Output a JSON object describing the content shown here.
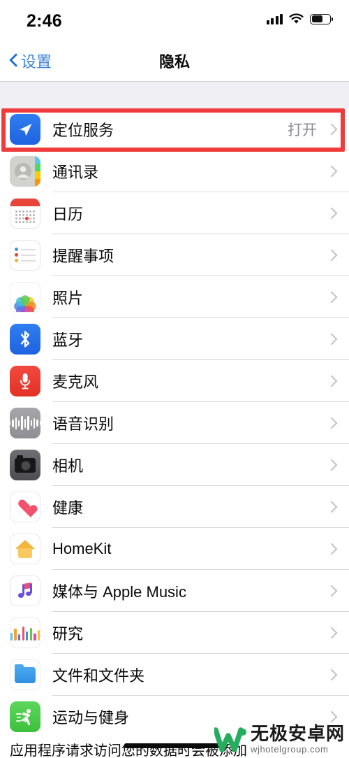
{
  "statusbar": {
    "time": "2:46",
    "signal_icon": "cellular-bars-icon",
    "wifi_icon": "wifi-icon",
    "battery_icon": "battery-icon",
    "battery_level_pct": 62
  },
  "navbar": {
    "back_label": "设置",
    "back_icon": "chevron-left-icon",
    "title": "隐私"
  },
  "highlight": {
    "color": "#ef3b3b",
    "target": "定位服务"
  },
  "list": {
    "rows": [
      {
        "label": "定位服务",
        "value": "打开",
        "icon": "location-arrow-icon",
        "chevron": "chevron-right-icon"
      },
      {
        "label": "通讯录",
        "value": "",
        "icon": "contacts-icon",
        "chevron": "chevron-right-icon"
      },
      {
        "label": "日历",
        "value": "",
        "icon": "calendar-icon",
        "chevron": "chevron-right-icon"
      },
      {
        "label": "提醒事项",
        "value": "",
        "icon": "reminders-icon",
        "chevron": "chevron-right-icon"
      },
      {
        "label": "照片",
        "value": "",
        "icon": "photos-icon",
        "chevron": "chevron-right-icon"
      },
      {
        "label": "蓝牙",
        "value": "",
        "icon": "bluetooth-icon",
        "chevron": "chevron-right-icon"
      },
      {
        "label": "麦克风",
        "value": "",
        "icon": "microphone-icon",
        "chevron": "chevron-right-icon"
      },
      {
        "label": "语音识别",
        "value": "",
        "icon": "speech-recognition-icon",
        "chevron": "chevron-right-icon"
      },
      {
        "label": "相机",
        "value": "",
        "icon": "camera-icon",
        "chevron": "chevron-right-icon"
      },
      {
        "label": "健康",
        "value": "",
        "icon": "health-heart-icon",
        "chevron": "chevron-right-icon"
      },
      {
        "label": "HomeKit",
        "value": "",
        "icon": "homekit-house-icon",
        "chevron": "chevron-right-icon"
      },
      {
        "label": "媒体与 Apple Music",
        "value": "",
        "icon": "apple-music-note-icon",
        "chevron": "chevron-right-icon"
      },
      {
        "label": "研究",
        "value": "",
        "icon": "research-chart-icon",
        "chevron": "chevron-right-icon"
      },
      {
        "label": "文件和文件夹",
        "value": "",
        "icon": "files-folder-icon",
        "chevron": "chevron-right-icon"
      },
      {
        "label": "运动与健身",
        "value": "",
        "icon": "fitness-runner-icon",
        "chevron": "chevron-right-icon"
      }
    ]
  },
  "footer": {
    "note": "应用程序请求访问您的数据时会被添加"
  },
  "watermark": {
    "name": "无极安卓网",
    "url": "wjhotelgroup.com",
    "color": "#25ad5f"
  },
  "colors": {
    "accent_blue": "#3b82d6",
    "highlight_red": "#ef3b3b",
    "group_background": "#efeff4",
    "separator": "#d8d8dc",
    "value_gray": "#8b8b90"
  }
}
